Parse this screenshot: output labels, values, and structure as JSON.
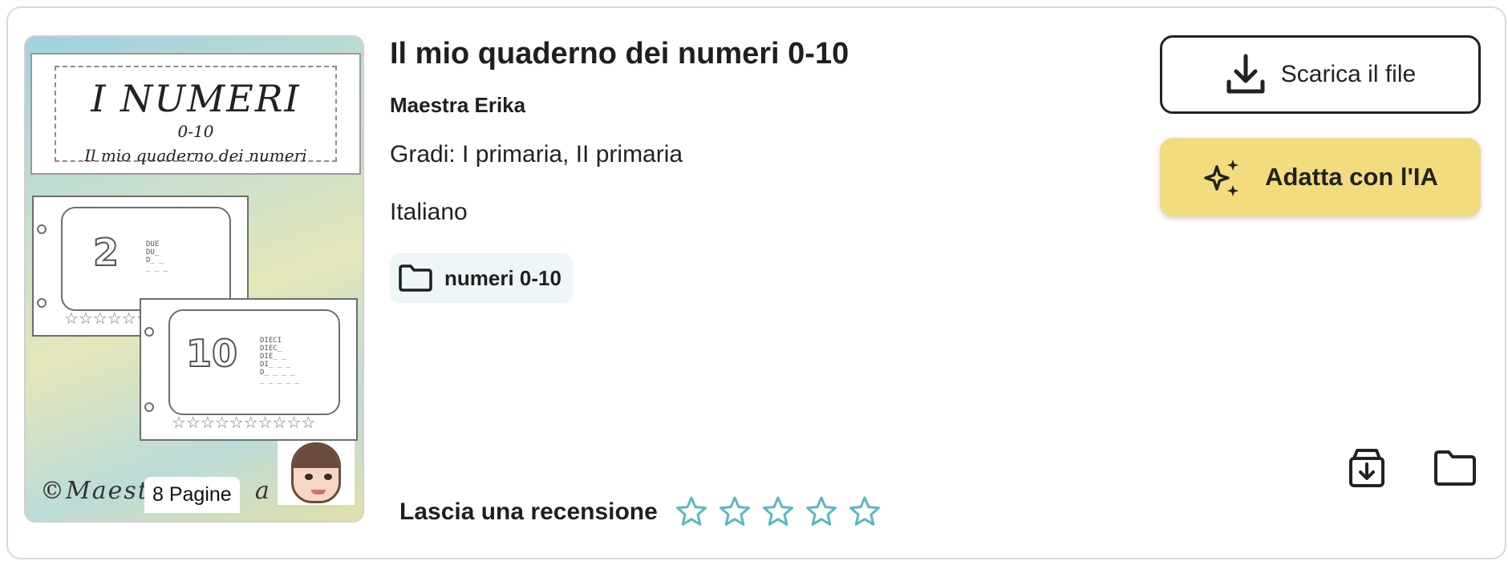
{
  "resource": {
    "title": "Il mio quaderno dei numeri 0-10",
    "author": "Maestra Erika",
    "grades": "Gradi: I primaria, II primaria",
    "subject": "Italiano",
    "collection": "numeri 0-10"
  },
  "thumbnail": {
    "cover_title": "I NUMERI",
    "cover_range": "0-10",
    "cover_subtitle": "Il mio quaderno dei numeri",
    "sheet_a_digit": "2",
    "sheet_a_words": [
      "DUE",
      "DU_",
      "D_ _",
      "_ _ _"
    ],
    "sheet_b_digit": "10",
    "sheet_b_words": [
      "DIECI",
      "DIEC_",
      "DIE_ _",
      "DI_ _ _",
      "D_ _ _ _",
      "_ _ _ _ _"
    ],
    "stars": "☆☆☆☆☆☆☆☆☆☆",
    "watermark": "©Maest",
    "watermark_end": "a",
    "pages_badge": "8 Pagine"
  },
  "actions": {
    "download_label": "Scarica il file",
    "ai_label": "Adatta con l'IA",
    "archive_icon": "archive-download-icon",
    "folder_icon": "folder-icon"
  },
  "review": {
    "label": "Lascia una recensione",
    "max_stars": 5,
    "rating": 0,
    "star_color": "#5bb8bf"
  },
  "colors": {
    "ai_button_bg": "#f2dc7e",
    "chip_bg": "#eef6f7",
    "border": "#d9d9d9"
  }
}
